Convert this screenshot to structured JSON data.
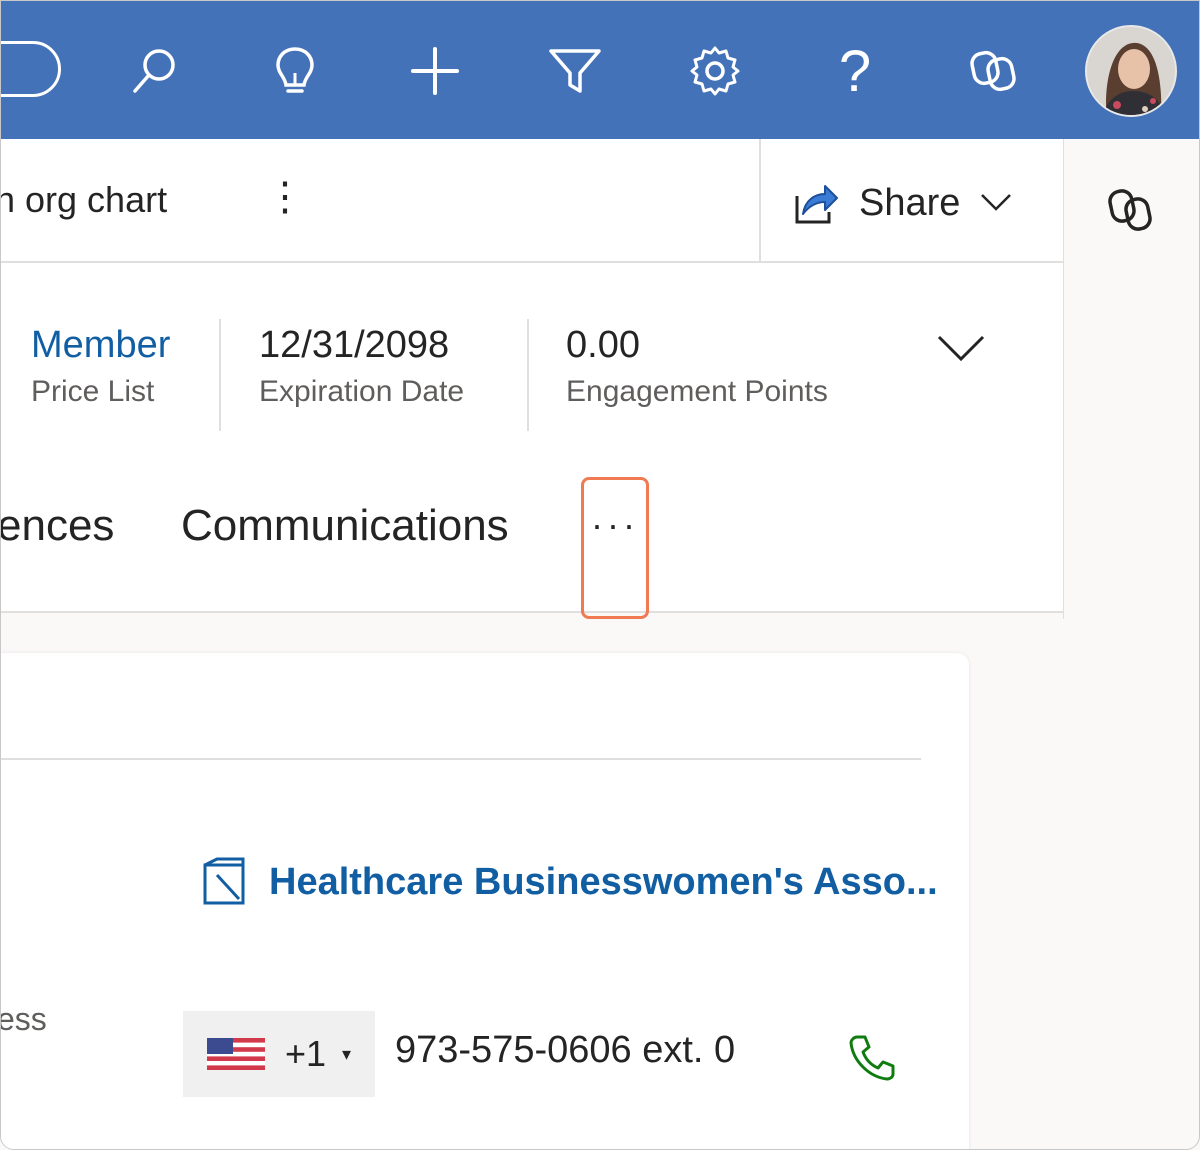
{
  "topbar": {
    "icons": [
      "search-icon",
      "lightbulb-icon",
      "plus-icon",
      "filter-icon",
      "gear-icon",
      "help-icon",
      "copilot-icon"
    ],
    "help_label": "?"
  },
  "command_bar": {
    "org_chart_label": "n org chart",
    "more_label": "⋮",
    "share_label": "Share"
  },
  "header": {
    "fields": [
      {
        "value": "Member",
        "label": "Price List"
      },
      {
        "value": "12/31/2098",
        "label": "Expiration Date"
      },
      {
        "value": "0.00",
        "label": "Engagement Points"
      }
    ],
    "colors": {
      "link": "#115ea3",
      "topbar": "#4472b8",
      "highlight": "#f07a52"
    }
  },
  "tabs": {
    "items": [
      "ences",
      "Communications"
    ],
    "more_label": "···"
  },
  "card": {
    "account_name": "Healthcare Businesswomen's Asso...",
    "address_label": "ess",
    "phone": {
      "country_code": "+1",
      "caret": "▾",
      "number": "973-575-0606 ext. 0"
    }
  }
}
